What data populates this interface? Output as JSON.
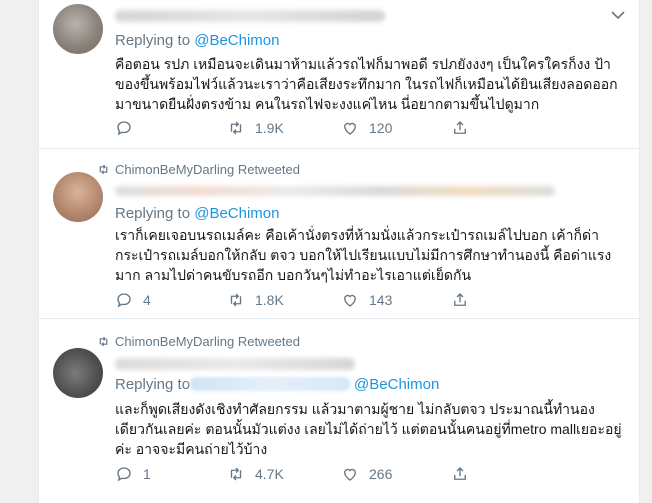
{
  "tweets": [
    {
      "retweet_label": "",
      "replying_prefix": "Replying to ",
      "mention": "@BeChimon",
      "text": "คือตอน รปภ เหมือนจะเดินมาห้ามแล้วรถไฟก็มาพอดี รปภยังงงๆ เป็นใครใครก็งง ป้าของขึ้นพร้อมไฟว์แล้วนะเราว่าคือเสียงระทึกมาก ในรถไฟก็เหมือนได้ยินเสียงลอดออกมาขนาดยืนฝั่งตรงข้าม คนในรถไฟจะงงแค่ไหน นี่อยากตามขึ้นไปดูมาก",
      "replies": "",
      "retweets": "1.9K",
      "likes": "120"
    },
    {
      "retweet_label": "ChimonBeMyDarling Retweeted",
      "replying_prefix": "Replying to ",
      "mention": "@BeChimon",
      "text": "เราก็เคยเจอบนรถเมล์คะ คือเค้านั่งตรงที่ห้ามนั่งแล้วกระเป๋ารถเมล์ไปบอก เค้าก็ด่ากระเป๋ารถเมล์บอกให้กลับ ตจว บอกให้ไปเรียนแบบไม่มีการศึกษาทำนองนี้ คือด่าแรงมาก ลามไปด่าคนขับรถอีก บอกวันๆไม่ทำอะไรเอาแต่เย็ดกัน",
      "replies": "4",
      "retweets": "1.8K",
      "likes": "143"
    },
    {
      "retweet_label": "ChimonBeMyDarling Retweeted",
      "replying_prefix": "Replying to",
      "mention": "@BeChimon",
      "text": "และก็พูดเสียงดังเชิงทำศัลยกรรม แล้วมาตามผู้ชาย ไม่กลับตจว ประมาณนี้ทำนองเดียวกันเลยค่ะ ตอนนั้นมัวแต่งง เลยไม่ได้ถ่ายไว้ แต่ตอนนั้นคนอยู่ที่metro mallเยอะอยู่ค่ะ อาจจะมีคนถ่ายไว้บ้าง",
      "replies": "1",
      "retweets": "4.7K",
      "likes": "266"
    }
  ],
  "colors": {
    "link": "#1b95e0",
    "muted": "#657786",
    "text": "#14171a",
    "border": "#e6ecf0"
  },
  "icons": [
    "reply-icon",
    "retweet-icon",
    "like-icon",
    "share-icon",
    "chevron-down-icon"
  ]
}
